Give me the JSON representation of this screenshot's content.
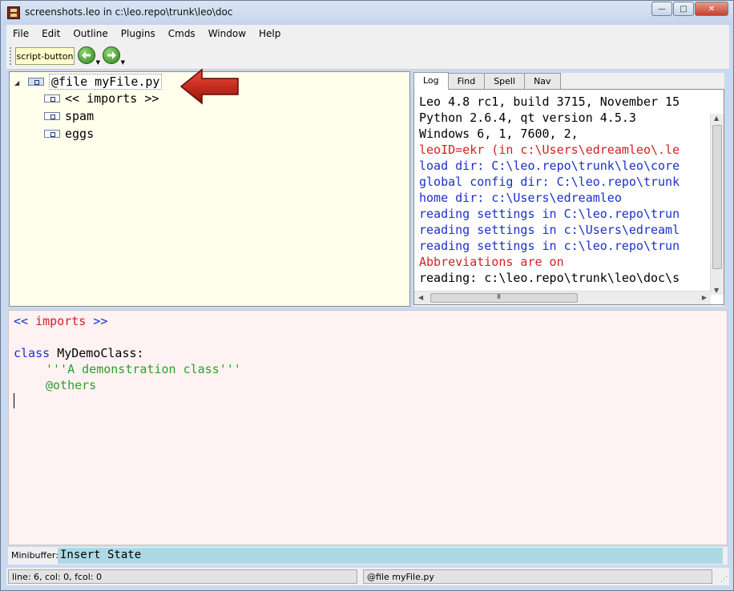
{
  "window": {
    "title": "screenshots.leo in c:\\leo.repo\\trunk\\leo\\doc",
    "minimize_glyph": "—",
    "maximize_glyph": "□",
    "close_glyph": "✕"
  },
  "menubar": {
    "items": [
      "File",
      "Edit",
      "Outline",
      "Plugins",
      "Cmds",
      "Window",
      "Help"
    ]
  },
  "toolbar": {
    "script_button_label": "script-button",
    "back_icon": "back-arrow-icon",
    "forward_icon": "forward-arrow-icon"
  },
  "outline": {
    "nodes": [
      {
        "headline": "@file myFile.py",
        "selected": true,
        "expanded": true
      },
      {
        "headline": "<< imports >>"
      },
      {
        "headline": "spam"
      },
      {
        "headline": "eggs"
      }
    ],
    "expander_glyph": "◢"
  },
  "log_pane": {
    "tabs": [
      "Log",
      "Find",
      "Spell",
      "Nav"
    ],
    "active_tab": "Log",
    "lines": [
      {
        "text": "Leo 4.8 rc1, build 3715, November 15",
        "color": "#000000"
      },
      {
        "text": "Python 2.6.4, qt version 4.5.3",
        "color": "#000000"
      },
      {
        "text": "Windows 6, 1, 7600, 2,",
        "color": "#000000"
      },
      {
        "text": "leoID=ekr (in c:\\Users\\edreamleo\\.le",
        "color": "#d42020"
      },
      {
        "text": "load dir: C:\\leo.repo\\trunk\\leo\\core",
        "color": "#1c2fc8"
      },
      {
        "text": "global config dir: C:\\leo.repo\\trunk",
        "color": "#1c2fc8"
      },
      {
        "text": "home dir: c:\\Users\\edreamleo",
        "color": "#1c2fc8"
      },
      {
        "text": "reading settings in C:\\leo.repo\\trun",
        "color": "#1c2fc8"
      },
      {
        "text": "reading settings in c:\\Users\\edreaml",
        "color": "#1c2fc8"
      },
      {
        "text": "reading settings in c:\\leo.repo\\trun",
        "color": "#1c2fc8"
      },
      {
        "text": "Abbreviations are on",
        "color": "#d42020"
      },
      {
        "text": "reading: c:\\leo.repo\\trunk\\leo\\doc\\s",
        "color": "#000000"
      }
    ]
  },
  "body_editor": {
    "imports_open": "<<",
    "imports_name": "imports",
    "imports_close": ">>",
    "class_keyword": "class",
    "class_name": "MyDemoClass:",
    "docstring": "'''A demonstration class'''",
    "others_directive": "@others",
    "colors": {
      "keyword": "#1c2fc8",
      "section_name": "#d42020",
      "docstring": "#2ca02c",
      "directive": "#2ca02c",
      "background": "#fff2f2"
    }
  },
  "minibuffer": {
    "label": "Minibuffer:",
    "value": "Insert State"
  },
  "statusbar": {
    "position_text": "line: 6, col: 0, fcol: 0",
    "node_text": "@file myFile.py"
  }
}
